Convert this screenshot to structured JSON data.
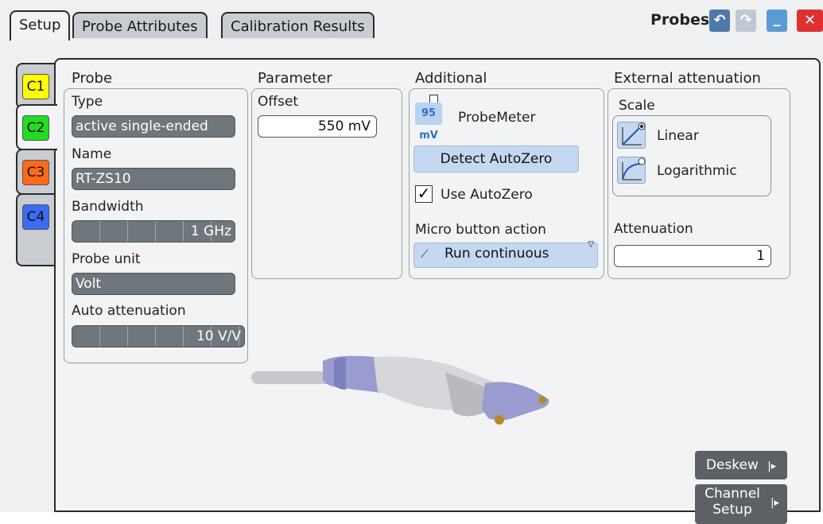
{
  "tabs": [
    {
      "label": "Setup"
    },
    {
      "label": "Probe Attributes"
    },
    {
      "label": "Calibration Results"
    }
  ],
  "title": "Probes",
  "channels": [
    {
      "label": "C1",
      "color": "#ffff00"
    },
    {
      "label": "C2",
      "color": "#22dd22"
    },
    {
      "label": "C3",
      "color": "#ff6a1a"
    },
    {
      "label": "C4",
      "color": "#3b6cf5"
    }
  ],
  "probe": {
    "heading": "Probe",
    "type_label": "Type",
    "type_value": "active single-ended",
    "name_label": "Name",
    "name_value": "RT-ZS10",
    "bandwidth_label": "Bandwidth",
    "bandwidth_value": "1 GHz",
    "unit_label": "Probe unit",
    "unit_value": "Volt",
    "auto_att_label": "Auto attenuation",
    "auto_att_value": "10 V/V"
  },
  "parameter": {
    "heading": "Parameter",
    "offset_label": "Offset",
    "offset_value": "550 mV"
  },
  "additional": {
    "heading": "Additional",
    "probemeter_label": "ProbeMeter",
    "probemeter_icon_text": "95 mV",
    "detect_label": "Detect AutoZero",
    "use_autozero_label": "Use AutoZero",
    "micro_label": "Micro button action",
    "micro_value": "Run continuous"
  },
  "external": {
    "heading": "External attenuation",
    "scale_label": "Scale",
    "linear_label": "Linear",
    "log_label": "Logarithmic",
    "att_label": "Attenuation",
    "att_value": "1"
  },
  "buttons": {
    "deskew": "Deskew",
    "channel_setup_1": "Channel",
    "channel_setup_2": "Setup"
  }
}
